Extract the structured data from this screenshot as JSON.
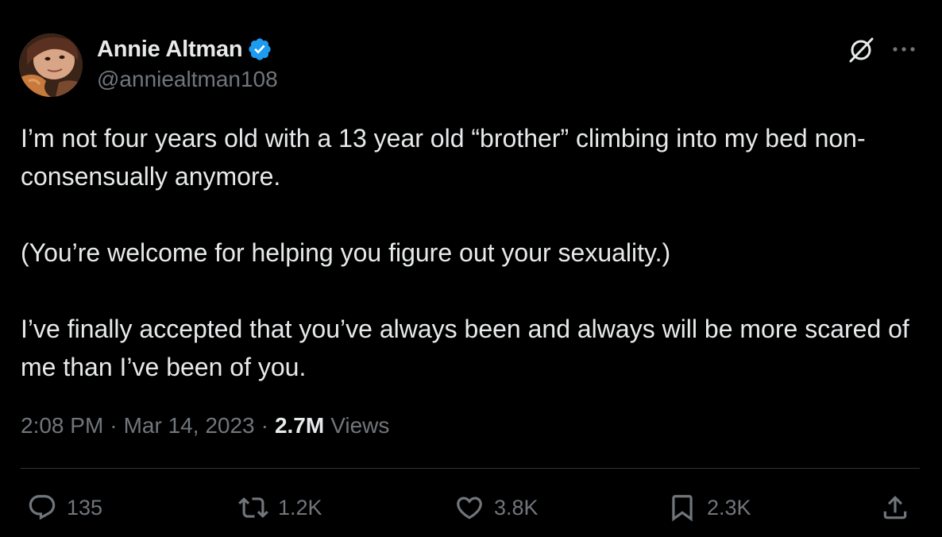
{
  "author": {
    "display_name": "Annie Altman",
    "handle": "@anniealtman108",
    "verified": true,
    "verified_color": "#1d9bf0"
  },
  "tweet": {
    "paragraphs": [
      "I’m not four years old with a 13 year old “brother” climbing into my bed non-consensually anymore.",
      "(You’re welcome for helping you figure out your sexuality.)",
      "I’ve finally accepted that you’ve always been and always will be more scared of me than I’ve been of you."
    ],
    "time": "2:08 PM",
    "date": "Mar 14, 2023",
    "views_count": "2.7M",
    "views_label": "Views"
  },
  "actions": {
    "replies": "135",
    "retweets": "1.2K",
    "likes": "3.8K",
    "bookmarks": "2.3K"
  },
  "icons": {
    "header": [
      "grok-icon",
      "more-icon"
    ],
    "actions": [
      "reply-icon",
      "retweet-icon",
      "like-icon",
      "bookmark-icon",
      "share-icon"
    ]
  },
  "colors": {
    "background": "#000000",
    "text": "#e7e9ea",
    "secondary": "#71767b",
    "divider": "#2f3336"
  }
}
